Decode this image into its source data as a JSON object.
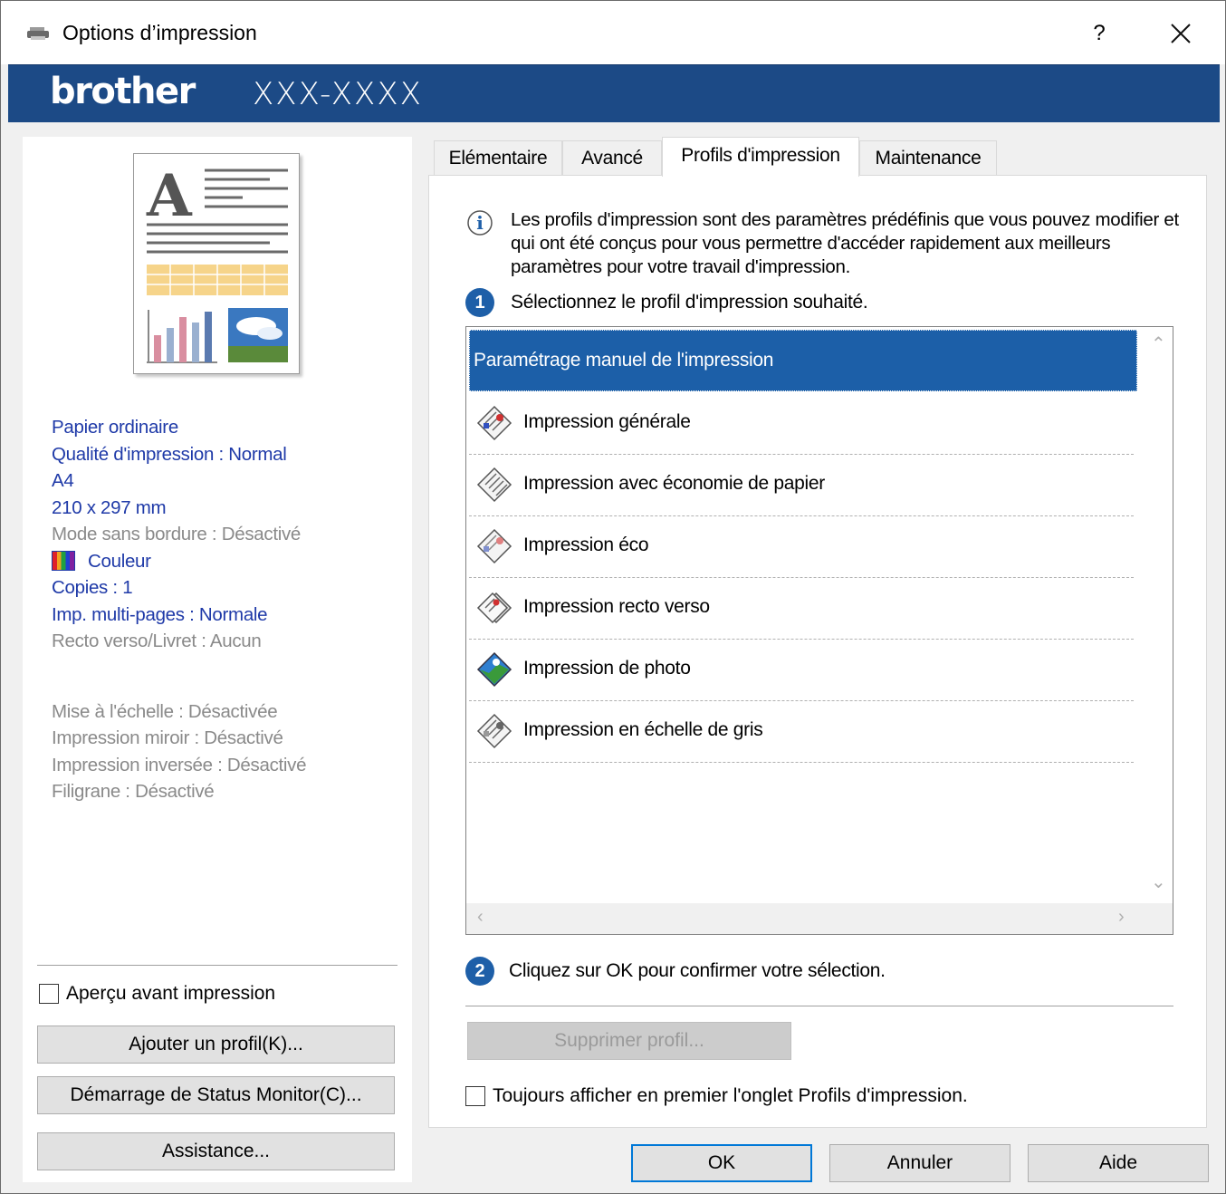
{
  "window": {
    "title": "Options d’impression",
    "help_label": "?",
    "close_icon": "close-icon"
  },
  "brand": {
    "logo": "brother",
    "model": "XXX-XXXX"
  },
  "left": {
    "info": [
      {
        "text": "Papier ordinaire",
        "style": "blue"
      },
      {
        "text": "Qualité d'impression : Normal",
        "style": "blue"
      },
      {
        "text": "A4",
        "style": "blue"
      },
      {
        "text": "210 x 297 mm",
        "style": "blue"
      },
      {
        "text": "Mode sans bordure : Désactivé",
        "style": "gray"
      },
      {
        "text": "Couleur",
        "style": "blue"
      },
      {
        "text": "Copies : 1",
        "style": "blue"
      },
      {
        "text": "Imp. multi-pages : Normale",
        "style": "blue"
      },
      {
        "text": "Recto verso/Livret : Aucun",
        "style": "gray"
      },
      {
        "text": "Mise à l'échelle : Désactivée",
        "style": "gray"
      },
      {
        "text": "Impression miroir : Désactivé",
        "style": "gray"
      },
      {
        "text": "Impression inversée : Désactivé",
        "style": "gray"
      },
      {
        "text": "Filigrane : Désactivé",
        "style": "gray"
      }
    ],
    "preview_checkbox": "Aperçu avant impression",
    "add_profile": "Ajouter un profil(K)...",
    "status_monitor": "Démarrage de Status Monitor(C)...",
    "assistance": "Assistance..."
  },
  "tabs": [
    "Elémentaire",
    "Avancé",
    "Profils d'impression",
    "Maintenance"
  ],
  "active_tab": "Profils d'impression",
  "profiles": {
    "intro": "Les profils d'impression sont des paramètres prédéfinis que vous pouvez modifier et qui ont été conçus pour vous permettre d'accéder rapidement aux meilleurs paramètres pour votre travail d'impression.",
    "step1": "Sélectionnez le profil d'impression souhaité.",
    "step1_num": "1",
    "items": [
      {
        "label": "Paramétrage manuel de l'impression",
        "selected": true,
        "icon": "none"
      },
      {
        "label": "Impression générale",
        "selected": false,
        "icon": "general-print-icon"
      },
      {
        "label": "Impression avec économie de papier",
        "selected": false,
        "icon": "paper-saving-icon"
      },
      {
        "label": "Impression éco",
        "selected": false,
        "icon": "eco-print-icon"
      },
      {
        "label": "Impression recto verso",
        "selected": false,
        "icon": "duplex-print-icon"
      },
      {
        "label": "Impression de photo",
        "selected": false,
        "icon": "photo-print-icon"
      },
      {
        "label": "Impression en échelle de gris",
        "selected": false,
        "icon": "grayscale-print-icon"
      }
    ],
    "step2": "Cliquez sur OK pour confirmer votre sélection.",
    "step2_num": "2",
    "delete_profile": "Supprimer profil...",
    "always_show": "Toujours afficher en premier l'onglet Profils d'impression."
  },
  "footer": {
    "ok": "OK",
    "cancel": "Annuler",
    "help": "Aide"
  },
  "colors": {
    "brand_bar": "#1c4a86",
    "selection": "#1c5fa8",
    "info_blue": "#1f3aa8",
    "info_gray": "#8a8a8a"
  }
}
